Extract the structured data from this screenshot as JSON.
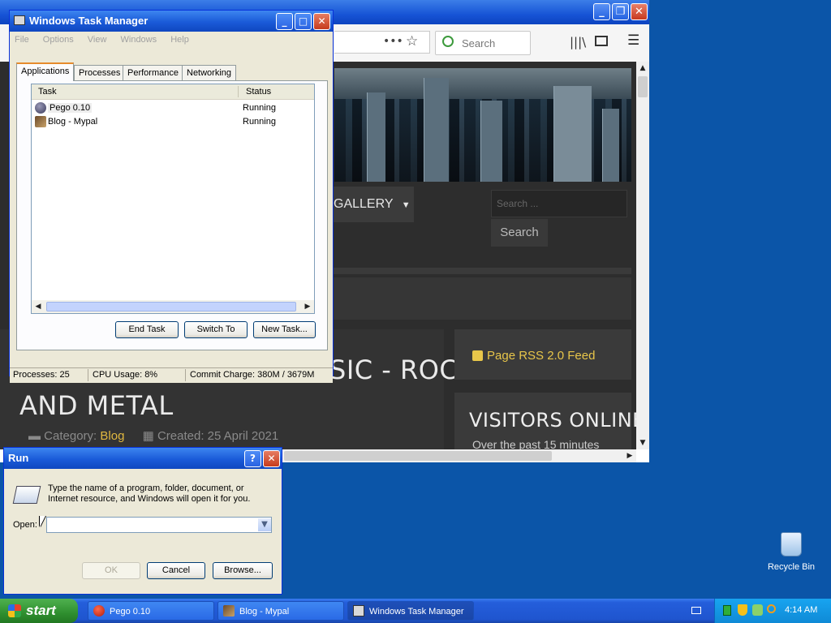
{
  "browser": {
    "search_placeholder": "Search",
    "site": {
      "menu_gallery": "GALLERY",
      "search_placeholder": "Search ...",
      "search_button": "Search",
      "post_title_line1": "CELLO CROSSOVER MUSIC - ROCK",
      "post_title_line2": "AND METAL",
      "category_label": "Category:",
      "category_value": "Blog",
      "created_label": "Created: 25 April 2021",
      "rss_feed": "Page RSS 2.0 Feed",
      "visitors_title": "VISITORS ONLINE",
      "visitors_sub": "Over the past 15 minutes"
    }
  },
  "task_manager": {
    "title": "Windows Task Manager",
    "menu": [
      "File",
      "Options",
      "View",
      "Windows",
      "Help"
    ],
    "tabs": [
      "Applications",
      "Processes",
      "Performance",
      "Networking"
    ],
    "columns": {
      "task": "Task",
      "status": "Status"
    },
    "rows": [
      {
        "task": "Pego 0.10",
        "status": "Running"
      },
      {
        "task": "Blog - Mypal",
        "status": "Running"
      }
    ],
    "buttons": {
      "end_task": "End Task",
      "switch_to": "Switch To",
      "new_task": "New Task..."
    },
    "status": {
      "processes": "Processes: 25",
      "cpu": "CPU Usage: 8%",
      "commit": "Commit Charge: 380M / 3679M"
    }
  },
  "run_dialog": {
    "title": "Run",
    "description_line1": "Type the name of a program, folder, document, or",
    "description_line2": "Internet resource, and Windows will open it for you.",
    "open_label": "Open:",
    "open_value": "",
    "buttons": {
      "ok": "OK",
      "cancel": "Cancel",
      "browse": "Browse..."
    }
  },
  "desktop": {
    "recycle_bin": "Recycle Bin"
  },
  "taskbar": {
    "start": "start",
    "tasks": [
      "Pego 0.10",
      "Blog - Mypal",
      "Windows Task Manager"
    ],
    "clock": "4:14 AM"
  },
  "colors": {
    "desktop": "#0b55a8",
    "xp_title_blue": "#1a5ad8",
    "site_accent": "#e0b840"
  }
}
